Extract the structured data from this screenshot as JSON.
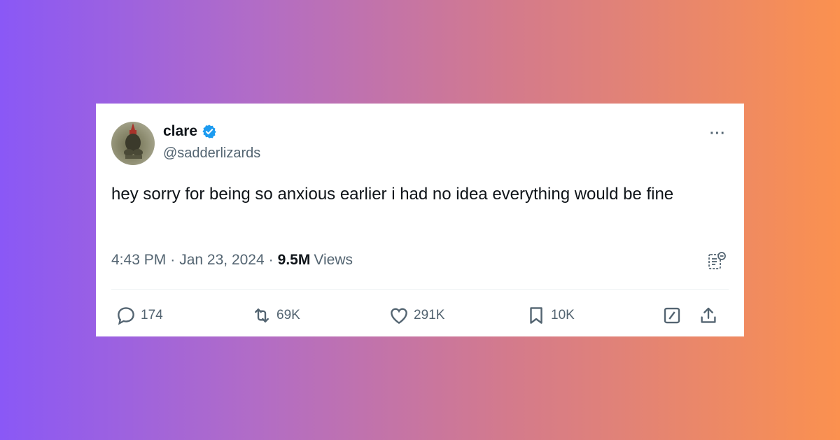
{
  "tweet": {
    "author": {
      "name": "clare",
      "handle": "@sadderlizards",
      "verified": true
    },
    "text": "hey sorry for being so anxious earlier i had no idea everything would be fine",
    "time": "4:43 PM",
    "separator": "·",
    "date": "Jan 23, 2024",
    "views_count": "9.5M",
    "views_label": "Views",
    "more_label": "···"
  },
  "actions": {
    "replies": "174",
    "reposts": "69K",
    "likes": "291K",
    "bookmarks": "10K"
  },
  "colors": {
    "text_primary": "#0f1419",
    "text_secondary": "#536471",
    "verified_blue": "#1d9bf0",
    "divider": "#eff3f4"
  },
  "icons": [
    "verified-badge-icon",
    "more-icon",
    "analytics-icon",
    "reply-icon",
    "repost-icon",
    "like-icon",
    "bookmark-icon",
    "grok-icon",
    "share-icon"
  ]
}
